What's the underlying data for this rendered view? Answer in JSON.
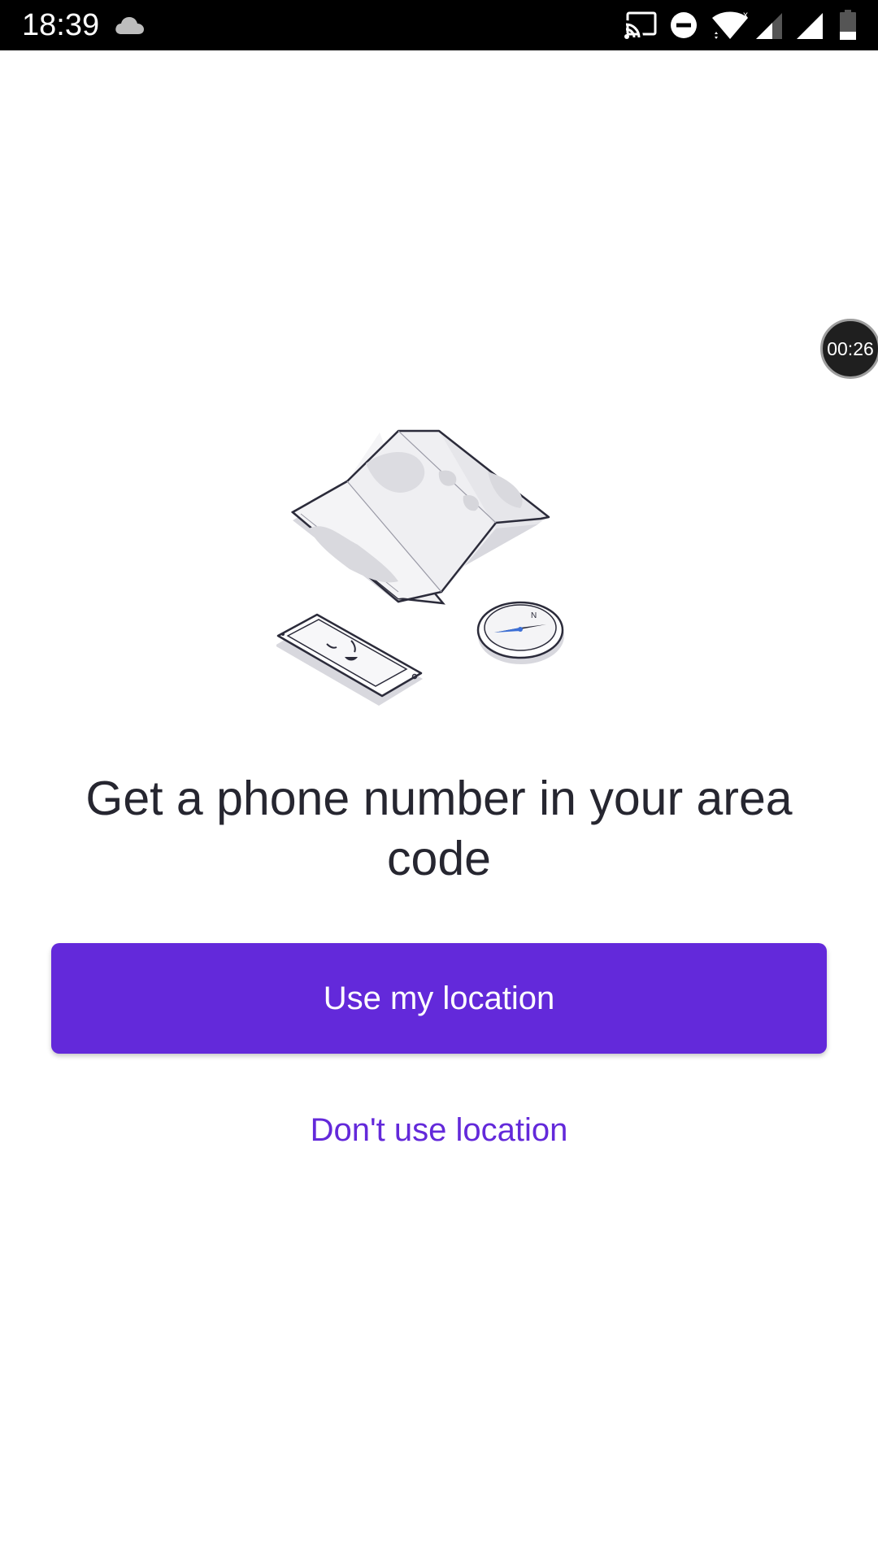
{
  "status_bar": {
    "time": "18:39",
    "icons": [
      "cloud-icon",
      "cast-icon",
      "do-not-disturb-icon",
      "wifi-icon",
      "signal-icon",
      "signal-icon",
      "battery-icon"
    ]
  },
  "timer": {
    "label": "00:26"
  },
  "illustration": {
    "icons": [
      "map-icon",
      "phone-icon",
      "compass-icon"
    ]
  },
  "main": {
    "headline": "Get a phone number in your area code",
    "primary_button": "Use my location",
    "secondary_button": "Don't use location"
  },
  "colors": {
    "accent": "#6329da",
    "text": "#262630",
    "status_bar": "#000000"
  }
}
